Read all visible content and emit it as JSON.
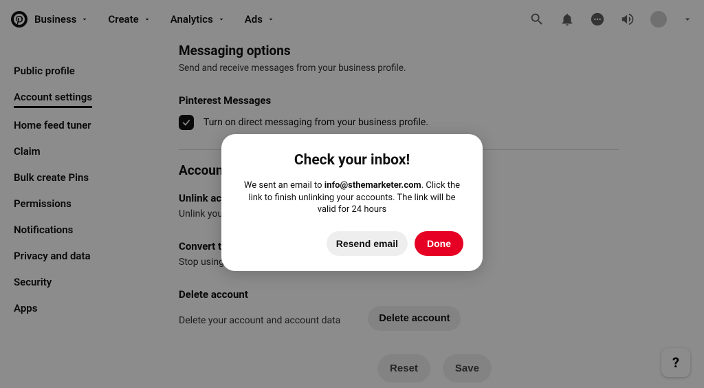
{
  "nav": {
    "business": "Business",
    "create": "Create",
    "analytics": "Analytics",
    "ads": "Ads"
  },
  "sidebar": {
    "items": [
      "Public profile",
      "Account settings",
      "Home feed tuner",
      "Claim",
      "Bulk create Pins",
      "Permissions",
      "Notifications",
      "Privacy and data",
      "Security",
      "Apps"
    ],
    "active_index": 1
  },
  "content": {
    "messaging_title": "Messaging options",
    "messaging_sub": "Send and receive messages from your business profile.",
    "pinterest_messages": "Pinterest Messages",
    "messaging_checkbox": "Turn on direct messaging from your business profile.",
    "account_heading": "Account",
    "unlink_heading": "Unlink acc",
    "unlink_text": "Unlink your personal ac",
    "convert_heading": "Convert to",
    "convert_text": "Stop using",
    "delete_heading": "Delete account",
    "delete_text": "Delete your account and account data",
    "delete_button": "Delete account"
  },
  "footer": {
    "reset": "Reset",
    "save": "Save"
  },
  "help": "?",
  "modal": {
    "title": "Check your inbox!",
    "prefix": "We sent an email to ",
    "email": "info@sthemarketer.com",
    "suffix": ". Click the link to finish unlinking your accounts. The link will be valid for 24 hours",
    "resend": "Resend email",
    "done": "Done"
  }
}
